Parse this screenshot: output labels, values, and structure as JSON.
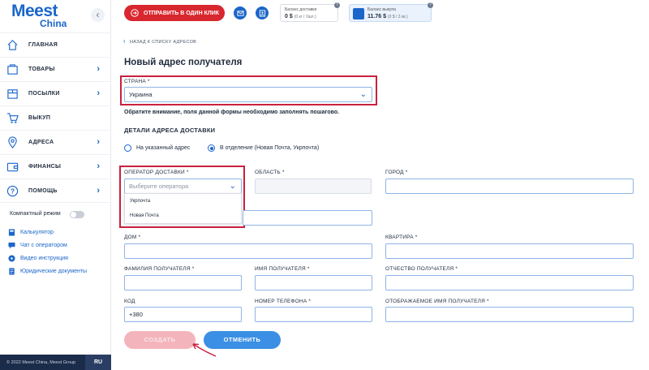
{
  "brand": {
    "name": "Meest",
    "sub": "China"
  },
  "sidebar": {
    "collapse_icon": "chevron-left-icon",
    "items": [
      {
        "label": "ГЛАВНАЯ",
        "icon": "home-icon",
        "chevron": false
      },
      {
        "label": "ТОВАРЫ",
        "icon": "cart-icon",
        "chevron": true
      },
      {
        "label": "ПОСЫЛКИ",
        "icon": "box-icon",
        "chevron": true
      },
      {
        "label": "ВЫКУП",
        "icon": "shopping-cart-icon",
        "chevron": false
      },
      {
        "label": "АДРЕСА",
        "icon": "location-pin-icon",
        "chevron": true
      },
      {
        "label": "ФИНАНСЫ",
        "icon": "wallet-icon",
        "chevron": true
      },
      {
        "label": "ПОМОЩЬ",
        "icon": "help-icon",
        "chevron": true
      }
    ],
    "compact_mode": {
      "label": "Компактный режим",
      "on": false
    },
    "links": [
      {
        "label": "Калькулятор",
        "icon": "calculator-icon"
      },
      {
        "label": "Чат с оператором",
        "icon": "chat-icon"
      },
      {
        "label": "Видео инструкция",
        "icon": "play-icon"
      },
      {
        "label": "Юридические документы",
        "icon": "document-icon"
      }
    ],
    "footer": {
      "copyright": "© 2022 Meest China, Meest Group",
      "lang": "RU"
    }
  },
  "topbar": {
    "order_button": "ОТПРАВИТЬ В ОДИН КЛИК",
    "delivery_balance": {
      "title": "Баланс доставки",
      "value": "0 $",
      "sub": "(0 кг / Ушл.)"
    },
    "purchase_balance": {
      "title": "Баланс выкупа",
      "value": "11.76 $",
      "sub": "(0 $ / 3 кв.)"
    },
    "help_mark": "?"
  },
  "main": {
    "back_link": "НАЗАД К СПИСКУ АДРЕСОВ",
    "title": "Новый адрес получателя",
    "country": {
      "label": "СТРАНА *",
      "value": "Украина"
    },
    "notice": "Обратите внимание, поля данной формы необходимо заполнять пошагово.",
    "section_title": "ДЕТАЛИ АДРЕСА ДОСТАВКИ",
    "radios": [
      {
        "label": "На указанный адрес",
        "selected": false
      },
      {
        "label": "В отделение (Новая Почта, Укрпочта)",
        "selected": true
      }
    ],
    "operator": {
      "label": "ОПЕРАТОР ДОСТАВКИ *",
      "placeholder": "Выберите оператора",
      "options": [
        "Укрпочта",
        "Новая Почта"
      ]
    },
    "region_label": "ОБЛАСТЬ *",
    "city_label": "ГОРОД *",
    "house_label": "ДОМ *",
    "apartment_label": "КВАРТИРА *",
    "last_name_label": "ФАМИЛИЯ ПОЛУЧАТЕЛЯ *",
    "first_name_label": "ИМЯ ПОЛУЧАТЕЛЯ *",
    "patronymic_label": "ОТЧЕСТВО ПОЛУЧАТЕЛЯ *",
    "code_label": "КОД",
    "code_value": "+380",
    "phone_label": "НОМЕР ТЕЛЕФОНА *",
    "display_name_label": "ОТОБРАЖАЕМОЕ ИМЯ ПОЛУЧАТЕЛЯ *",
    "create_button": "СОЗДАТЬ",
    "cancel_button": "ОТМЕНИТЬ"
  },
  "colors": {
    "brand_blue": "#1b66c9",
    "accent_red": "#d8272f",
    "highlight_frame": "#c9213d"
  }
}
